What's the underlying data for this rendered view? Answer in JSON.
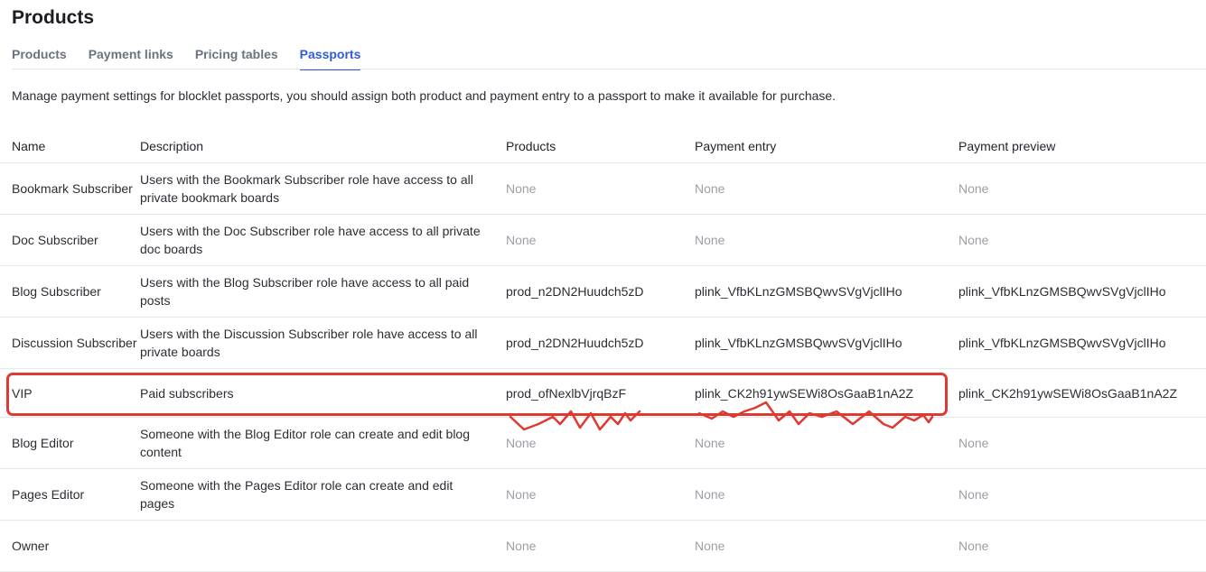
{
  "page": {
    "title": "Products"
  },
  "tabs": [
    {
      "label": "Products",
      "active": false
    },
    {
      "label": "Payment links",
      "active": false
    },
    {
      "label": "Pricing tables",
      "active": false
    },
    {
      "label": "Passports",
      "active": true
    }
  ],
  "intro": "Manage payment settings for blocklet passports, you should assign both product and payment entry to a passport to make it available for purchase.",
  "table": {
    "headers": [
      "Name",
      "Description",
      "Products",
      "Payment entry",
      "Payment preview"
    ],
    "rows": [
      {
        "name": "Bookmark Subscriber",
        "description": "Users with the Bookmark Subscriber role have access to all private bookmark boards",
        "products": "None",
        "payment_entry": "None",
        "payment_preview": "None"
      },
      {
        "name": "Doc Subscriber",
        "description": "Users with the Doc Subscriber role have access to all private doc boards",
        "products": "None",
        "payment_entry": "None",
        "payment_preview": "None"
      },
      {
        "name": "Blog Subscriber",
        "description": "Users with the Blog Subscriber role have access to all paid posts",
        "products": "prod_n2DN2Huudch5zD",
        "payment_entry": "plink_VfbKLnzGMSBQwvSVgVjclIHo",
        "payment_preview": "plink_VfbKLnzGMSBQwvSVgVjclIHo"
      },
      {
        "name": "Discussion Subscriber",
        "description": "Users with the Discussion Subscriber role have access to all private boards",
        "products": "prod_n2DN2Huudch5zD",
        "payment_entry": "plink_VfbKLnzGMSBQwvSVgVjclIHo",
        "payment_preview": "plink_VfbKLnzGMSBQwvSVgVjclIHo"
      },
      {
        "name": "VIP",
        "description": "Paid subscribers",
        "products": "prod_ofNexlbVjrqBzF",
        "payment_entry": "plink_CK2h91ywSEWi8OsGaaB1nA2Z",
        "payment_preview": "plink_CK2h91ywSEWi8OsGaaB1nA2Z"
      },
      {
        "name": "Blog Editor",
        "description": "Someone with the Blog Editor role can create and edit blog content",
        "products": "None",
        "payment_entry": "None",
        "payment_preview": "None"
      },
      {
        "name": "Pages Editor",
        "description": "Someone with the Pages Editor role can create and edit pages",
        "products": "None",
        "payment_entry": "None",
        "payment_preview": "None"
      },
      {
        "name": "Owner",
        "description": "",
        "products": "None",
        "payment_entry": "None",
        "payment_preview": "None"
      }
    ]
  },
  "annotation": {
    "color": "#dd3b32"
  }
}
